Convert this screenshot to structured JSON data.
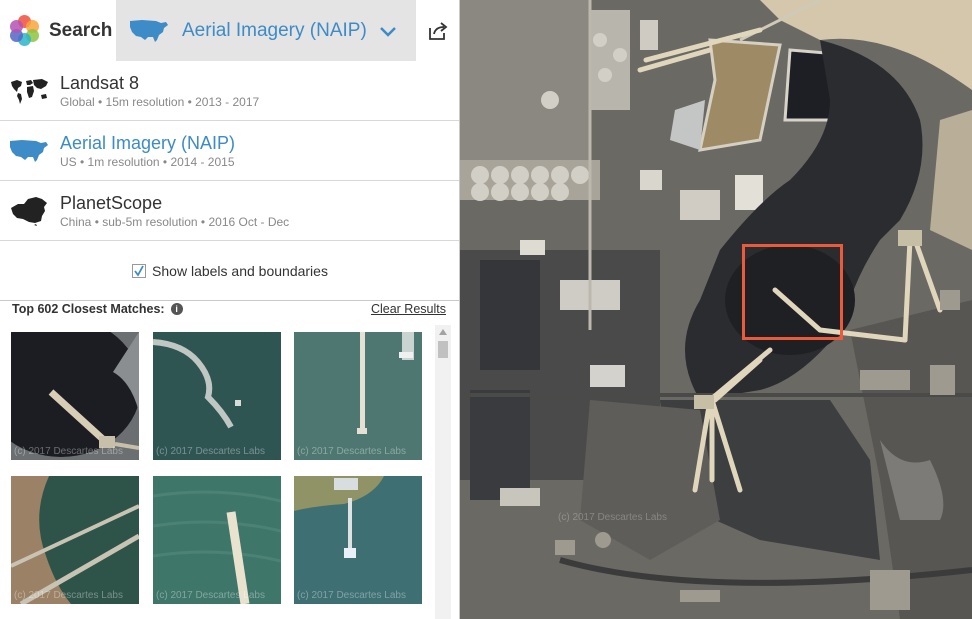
{
  "topbar": {
    "search_label": "Search",
    "selected_layer": "Aerial Imagery (NAIP)"
  },
  "layers": [
    {
      "name": "Landsat 8",
      "desc": "Global • 15m resolution • 2013 - 2017",
      "icon": "world-map-icon"
    },
    {
      "name": "Aerial Imagery (NAIP)",
      "desc": "US • 1m resolution • 2014 - 2015",
      "icon": "usa-map-icon",
      "active": true
    },
    {
      "name": "PlanetScope",
      "desc": "China • sub-5m resolution • 2016 Oct - Dec",
      "icon": "china-map-icon"
    }
  ],
  "options": {
    "show_labels": "Show labels and boundaries",
    "show_labels_checked": true
  },
  "results": {
    "title": "Top 602 Closest Matches:",
    "clear": "Clear Results",
    "watermark": "(c) 2017 Descartes Labs"
  },
  "colors": {
    "accent": "#3d8bc7",
    "selection": "#ec5a3c"
  }
}
